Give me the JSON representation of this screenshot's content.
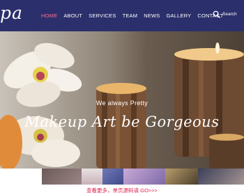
{
  "header": {
    "logo_text": "pa",
    "nav": [
      {
        "label": "HOME",
        "active": true
      },
      {
        "label": "ABOUT"
      },
      {
        "label": "SERVICES"
      },
      {
        "label": "TEAM"
      },
      {
        "label": "NEWS"
      },
      {
        "label": "GALLERY"
      },
      {
        "label": "CONTACT"
      }
    ],
    "search": {
      "placeholder": "Search",
      "icon": "search-icon"
    }
  },
  "hero": {
    "subtitle": "We always Pretty",
    "title": "Makeup Art be Gorgeous"
  },
  "footer": {
    "link_text": "查看更多，单页源码请 GO>>>"
  },
  "colors": {
    "navbar": "#2b2f6b",
    "active_nav": "#ff6f8f",
    "footer_link": "#e0224b"
  }
}
